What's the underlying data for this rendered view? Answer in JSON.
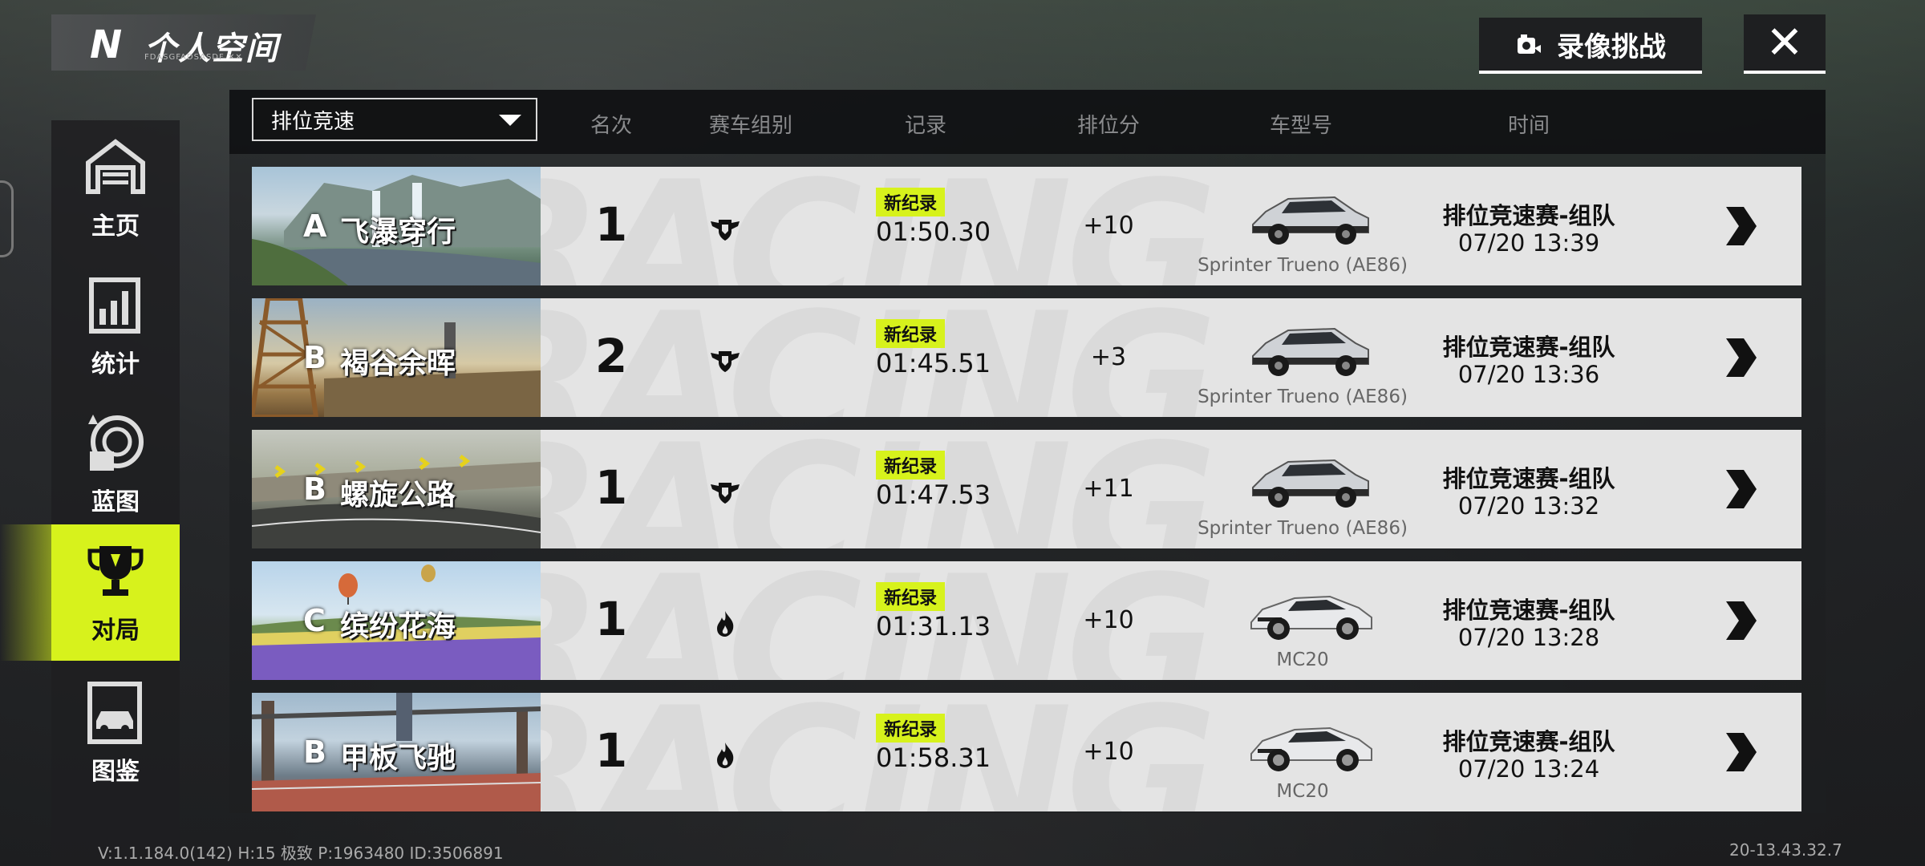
{
  "header": {
    "logo": "N",
    "title": "个人空间",
    "subtitle": "FDASGFADSASDF ✕✕",
    "record_button": "录像挑战",
    "close_symbol": "✕"
  },
  "sidebar": {
    "items": [
      {
        "label": "主页",
        "icon": "garage-icon"
      },
      {
        "label": "统计",
        "icon": "stats-icon"
      },
      {
        "label": "蓝图",
        "icon": "blueprint-icon"
      },
      {
        "label": "对局",
        "icon": "trophy-icon",
        "active": true
      },
      {
        "label": "图鉴",
        "icon": "car-catalog-icon"
      }
    ],
    "active_color": "#d7f21c"
  },
  "filter": {
    "selected": "排位竞速"
  },
  "columns": {
    "rank": "名次",
    "group": "赛车组别",
    "record": "记录",
    "score": "排位分",
    "car": "车型号",
    "time": "时间"
  },
  "rows": [
    {
      "tier": "A",
      "map": "飞瀑穿行",
      "rank": "1",
      "group_icon": "shield-wings-icon",
      "badge": "新纪录",
      "record": "01:50.30",
      "score": "+10",
      "car": "Sprinter Trueno (AE86)",
      "car_icon": "ae86-car-icon",
      "mode": "排位竞速赛-组队",
      "date": "07/20  13:39"
    },
    {
      "tier": "B",
      "map": "褐谷余晖",
      "rank": "2",
      "group_icon": "shield-wings-icon",
      "badge": "新纪录",
      "record": "01:45.51",
      "score": "+3",
      "car": "Sprinter Trueno (AE86)",
      "car_icon": "ae86-car-icon",
      "mode": "排位竞速赛-组队",
      "date": "07/20  13:36"
    },
    {
      "tier": "B",
      "map": "螺旋公路",
      "rank": "1",
      "group_icon": "shield-wings-icon",
      "badge": "新纪录",
      "record": "01:47.53",
      "score": "+11",
      "car": "Sprinter Trueno (AE86)",
      "car_icon": "ae86-car-icon",
      "mode": "排位竞速赛-组队",
      "date": "07/20  13:32"
    },
    {
      "tier": "C",
      "map": "缤纷花海",
      "rank": "1",
      "group_icon": "flame-icon",
      "badge": "新纪录",
      "record": "01:31.13",
      "score": "+10",
      "car": "MC20",
      "car_icon": "mc20-car-icon",
      "mode": "排位竞速赛-组队",
      "date": "07/20  13:28"
    },
    {
      "tier": "B",
      "map": "甲板飞驰",
      "rank": "1",
      "group_icon": "flame-icon",
      "badge": "新纪录",
      "record": "01:58.31",
      "score": "+10",
      "car": "MC20",
      "car_icon": "mc20-car-icon",
      "mode": "排位竞速赛-组队",
      "date": "07/20  13:24"
    }
  ],
  "footer": {
    "left": "V:1.1.184.0(142) H:15 极致 P:1963480 ID:3506891",
    "right": "20-13.43.32.7"
  }
}
